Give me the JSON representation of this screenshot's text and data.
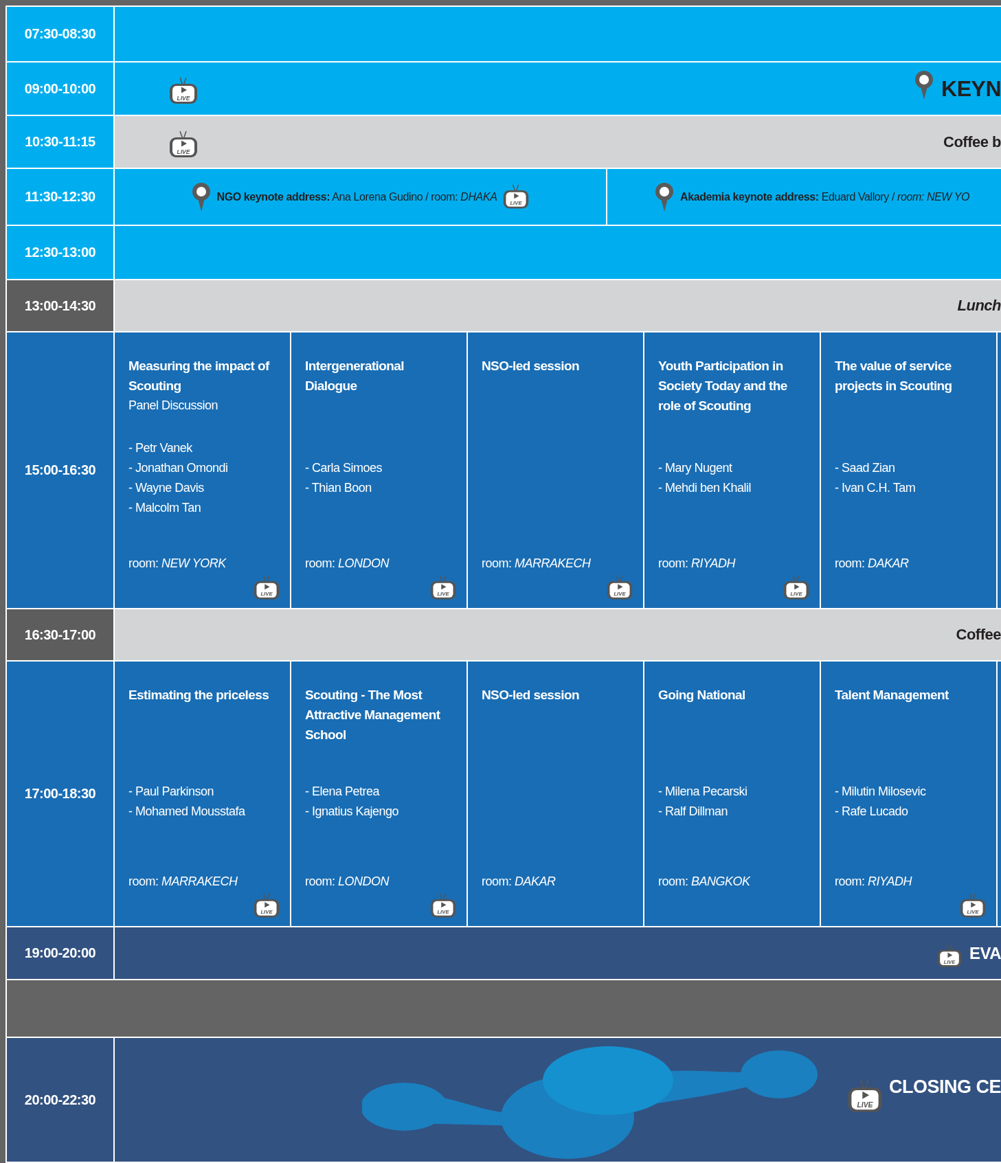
{
  "rows": [
    {
      "time": "07:30-08:30",
      "kind": "plenary"
    },
    {
      "time": "09:00-10:00",
      "kind": "plenary",
      "live_label": "LIVE",
      "pin": true,
      "title": "KEYN"
    },
    {
      "time": "10:30-11:15",
      "kind": "break",
      "live_label": "LIVE",
      "title": "Coffee b"
    },
    {
      "time": "11:30-12:30",
      "kind": "split",
      "halves": [
        {
          "text": "**NGO keynote address:** Ana Lorena Gudino / room: *DHAKA*",
          "live_label": "LIVE"
        },
        {
          "text": "**Akademia keynote address:** Eduard Vallory / *room: NEW YO*"
        }
      ]
    },
    {
      "time": "12:30-13:00",
      "kind": "plenary"
    },
    {
      "time": "13:00-14:30",
      "kind": "meal",
      "title": "Lunch"
    },
    {
      "time": "15:00-16:30",
      "kind": "sessions",
      "sessions": [
        {
          "title": "Measuring the impact of Scouting",
          "subtitle": "Panel Discussion",
          "speakers": [
            "- Petr Vanek",
            "- Jonathan Omondi",
            "- Wayne Davis",
            "- Malcolm Tan"
          ],
          "room": "room: *NEW YORK*",
          "live_label": "LIVE"
        },
        {
          "title": "Intergenerational Dialogue",
          "speakers": [
            "- Carla Simoes",
            "- Thian Boon"
          ],
          "room": "room: *LONDON*",
          "live_label": "LIVE"
        },
        {
          "title": "NSO-led session",
          "room": "room: *MARRAKECH*",
          "live_label": "LIVE"
        },
        {
          "title": "Youth Participation in Society Today and the role of Scouting",
          "speakers": [
            "- Mary Nugent",
            "- Mehdi ben Khalil"
          ],
          "room": "room: *RIYADH*",
          "live_label": "LIVE"
        },
        {
          "title": "The value of service projects in Scouting",
          "speakers": [
            "- Saad Zian",
            "- Ivan C.H. Tam"
          ],
          "room": "room: *DAKAR*"
        }
      ]
    },
    {
      "time": "16:30-17:00",
      "kind": "pause",
      "title": "Coffee"
    },
    {
      "time": "17:00-18:30",
      "kind": "sessions",
      "sessions": [
        {
          "title": "Estimating the priceless",
          "speakers": [
            "- Paul Parkinson",
            "- Mohamed Mousstafa"
          ],
          "room": "room: *MARRAKECH*",
          "live_label": "LIVE"
        },
        {
          "title": "Scouting - The Most Attractive Management School",
          "speakers": [
            "- Elena Petrea",
            "- Ignatius Kajengo"
          ],
          "room": "room: *LONDON*",
          "live_label": "LIVE"
        },
        {
          "title": "NSO-led session",
          "room": "room: *DAKAR*"
        },
        {
          "title": "Going National",
          "speakers": [
            "- Milena Pecarski",
            "- Ralf Dillman"
          ],
          "room": "room: *BANGKOK*"
        },
        {
          "title": "Talent Management",
          "speakers": [
            "- Milutin Milosevic",
            "- Rafe Lucado"
          ],
          "room": "room: *RIYADH*",
          "live_label": "LIVE"
        }
      ]
    },
    {
      "time": "19:00-20:00",
      "kind": "evening",
      "live_label": "LIVE",
      "title": "EVA"
    },
    {
      "time": "20:00-22:30",
      "kind": "closing",
      "live_label": "LIVE",
      "title": "CLOSING CE"
    }
  ]
}
